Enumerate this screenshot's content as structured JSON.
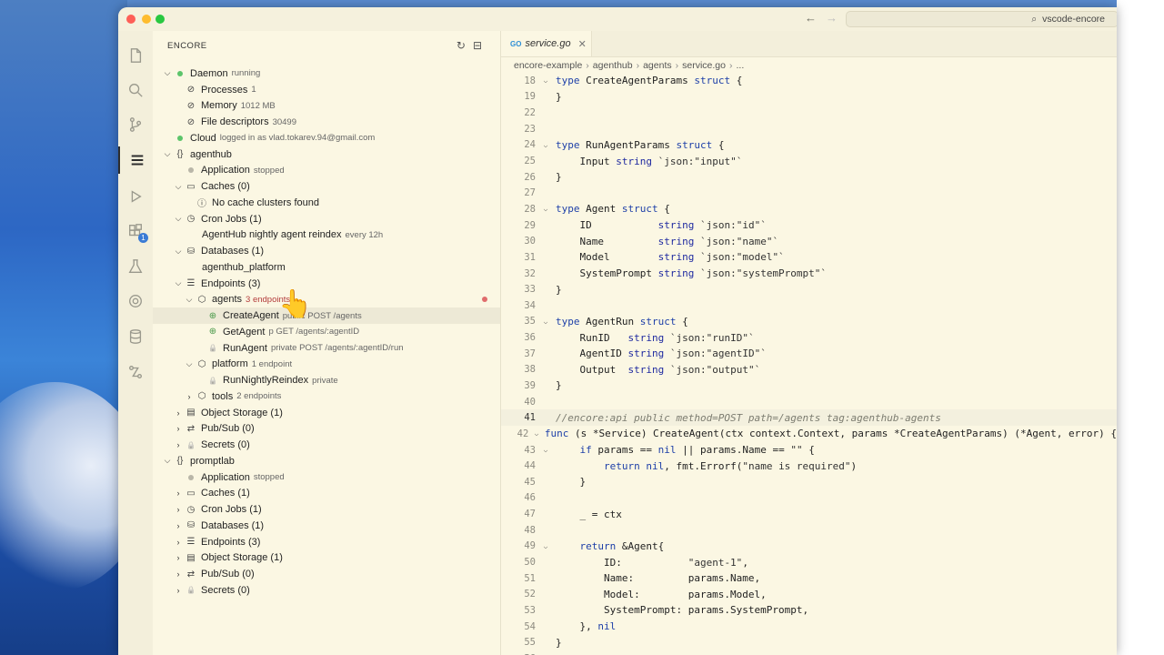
{
  "window": {
    "search_text": "vscode-encore"
  },
  "sidebar": {
    "header": "ENCORE",
    "rows": [
      {
        "indent": 0,
        "chev": "v",
        "icon": "status-dot-green",
        "label": "Daemon",
        "sub": "running"
      },
      {
        "indent": 1,
        "chev": "",
        "icon": "gauge-icon",
        "label": "Processes",
        "sub": "1"
      },
      {
        "indent": 1,
        "chev": "",
        "icon": "gauge-icon",
        "label": "Memory",
        "sub": "1012 MB"
      },
      {
        "indent": 1,
        "chev": "",
        "icon": "gauge-icon",
        "label": "File descriptors",
        "sub": "30499"
      },
      {
        "indent": 0,
        "chev": "",
        "icon": "status-dot-green",
        "label": "Cloud",
        "sub": "logged in as vlad.tokarev.94@gmail.com"
      },
      {
        "indent": 0,
        "chev": "v",
        "icon": "braces-icon",
        "label": "agenthub",
        "sub": ""
      },
      {
        "indent": 1,
        "chev": "",
        "icon": "status-dot-gray",
        "label": "Application",
        "sub": "stopped"
      },
      {
        "indent": 1,
        "chev": "v",
        "icon": "cache-icon",
        "label": "Caches (0)",
        "sub": ""
      },
      {
        "indent": 2,
        "chev": "",
        "icon": "info-icon",
        "label": "No cache clusters found",
        "sub": ""
      },
      {
        "indent": 1,
        "chev": "v",
        "icon": "clock-icon",
        "label": "Cron Jobs (1)",
        "sub": ""
      },
      {
        "indent": 2,
        "chev": "",
        "icon": "",
        "label": "AgentHub nightly agent reindex",
        "sub": "every 12h"
      },
      {
        "indent": 1,
        "chev": "v",
        "icon": "database-icon",
        "label": "Databases (1)",
        "sub": ""
      },
      {
        "indent": 2,
        "chev": "",
        "icon": "",
        "label": "agenthub_platform",
        "sub": ""
      },
      {
        "indent": 1,
        "chev": "v",
        "icon": "list-icon",
        "label": "Endpoints (3)",
        "sub": ""
      },
      {
        "indent": 2,
        "chev": "v",
        "icon": "box-icon",
        "label": "agents",
        "sub": "3 endpoints",
        "sub_red": true,
        "red_dot": true
      },
      {
        "indent": 3,
        "chev": "",
        "icon": "globe-icon",
        "label": "CreateAgent",
        "sub": "public  POST  /agents",
        "selected": true
      },
      {
        "indent": 3,
        "chev": "",
        "icon": "globe-icon",
        "label": "GetAgent",
        "sub": "p      GET  /agents/:agentID"
      },
      {
        "indent": 3,
        "chev": "",
        "icon": "lock-icon",
        "label": "RunAgent",
        "sub": "private  POST  /agents/:agentID/run"
      },
      {
        "indent": 2,
        "chev": "v",
        "icon": "box-icon",
        "label": "platform",
        "sub": "1 endpoint"
      },
      {
        "indent": 3,
        "chev": "",
        "icon": "lock-icon",
        "label": "RunNightlyReindex",
        "sub": "private"
      },
      {
        "indent": 2,
        "chev": ">",
        "icon": "box-icon",
        "label": "tools",
        "sub": "2 endpoints"
      },
      {
        "indent": 1,
        "chev": ">",
        "icon": "bucket-icon",
        "label": "Object Storage (1)",
        "sub": ""
      },
      {
        "indent": 1,
        "chev": ">",
        "icon": "pubsub-icon",
        "label": "Pub/Sub (0)",
        "sub": ""
      },
      {
        "indent": 1,
        "chev": ">",
        "icon": "lock-icon",
        "label": "Secrets (0)",
        "sub": ""
      },
      {
        "indent": 0,
        "chev": "v",
        "icon": "braces-icon",
        "label": "promptlab",
        "sub": ""
      },
      {
        "indent": 1,
        "chev": "",
        "icon": "status-dot-gray",
        "label": "Application",
        "sub": "stopped"
      },
      {
        "indent": 1,
        "chev": ">",
        "icon": "cache-icon",
        "label": "Caches (1)",
        "sub": ""
      },
      {
        "indent": 1,
        "chev": ">",
        "icon": "clock-icon",
        "label": "Cron Jobs (1)",
        "sub": ""
      },
      {
        "indent": 1,
        "chev": ">",
        "icon": "database-icon",
        "label": "Databases (1)",
        "sub": ""
      },
      {
        "indent": 1,
        "chev": ">",
        "icon": "list-icon",
        "label": "Endpoints (3)",
        "sub": ""
      },
      {
        "indent": 1,
        "chev": ">",
        "icon": "bucket-icon",
        "label": "Object Storage (1)",
        "sub": ""
      },
      {
        "indent": 1,
        "chev": ">",
        "icon": "pubsub-icon",
        "label": "Pub/Sub (0)",
        "sub": ""
      },
      {
        "indent": 1,
        "chev": ">",
        "icon": "lock-icon",
        "label": "Secrets (0)",
        "sub": ""
      }
    ]
  },
  "editor": {
    "tab_label": "service.go",
    "tab_badge": "GO",
    "breadcrumbs": [
      "encore-example",
      "agenthub",
      "agents",
      "service.go",
      "..."
    ],
    "active_line": "41",
    "lines": [
      {
        "n": "18",
        "fold": "v",
        "text": "type CreateAgentParams struct {"
      },
      {
        "n": "19",
        "fold": "",
        "text": "}"
      },
      {
        "n": "22",
        "fold": "",
        "text": ""
      },
      {
        "n": "23",
        "fold": "",
        "text": ""
      },
      {
        "n": "24",
        "fold": "v",
        "text": "type RunAgentParams struct {"
      },
      {
        "n": "25",
        "fold": "",
        "text": "    Input string `json:\"input\"`"
      },
      {
        "n": "26",
        "fold": "",
        "text": "}"
      },
      {
        "n": "27",
        "fold": "",
        "text": ""
      },
      {
        "n": "28",
        "fold": "v",
        "text": "type Agent struct {"
      },
      {
        "n": "29",
        "fold": "",
        "text": "    ID           string `json:\"id\"`"
      },
      {
        "n": "30",
        "fold": "",
        "text": "    Name         string `json:\"name\"`"
      },
      {
        "n": "31",
        "fold": "",
        "text": "    Model        string `json:\"model\"`"
      },
      {
        "n": "32",
        "fold": "",
        "text": "    SystemPrompt string `json:\"systemPrompt\"`"
      },
      {
        "n": "33",
        "fold": "",
        "text": "}"
      },
      {
        "n": "34",
        "fold": "",
        "text": ""
      },
      {
        "n": "35",
        "fold": "v",
        "text": "type AgentRun struct {"
      },
      {
        "n": "36",
        "fold": "",
        "text": "    RunID   string `json:\"runID\"`"
      },
      {
        "n": "37",
        "fold": "",
        "text": "    AgentID string `json:\"agentID\"`"
      },
      {
        "n": "38",
        "fold": "",
        "text": "    Output  string `json:\"output\"`"
      },
      {
        "n": "39",
        "fold": "",
        "text": "}"
      },
      {
        "n": "40",
        "fold": "",
        "text": ""
      },
      {
        "n": "41",
        "fold": "",
        "text": "//encore:api public method=POST path=/agents tag:agenthub-agents"
      },
      {
        "n": "42",
        "fold": "v",
        "text": "func (s *Service) CreateAgent(ctx context.Context, params *CreateAgentParams) (*Agent, error) {"
      },
      {
        "n": "43",
        "fold": "v",
        "text": "    if params == nil || params.Name == \"\" {"
      },
      {
        "n": "44",
        "fold": "",
        "text": "        return nil, fmt.Errorf(\"name is required\")"
      },
      {
        "n": "45",
        "fold": "",
        "text": "    }"
      },
      {
        "n": "46",
        "fold": "",
        "text": ""
      },
      {
        "n": "47",
        "fold": "",
        "text": "    _ = ctx"
      },
      {
        "n": "48",
        "fold": "",
        "text": ""
      },
      {
        "n": "49",
        "fold": "v",
        "text": "    return &Agent{"
      },
      {
        "n": "50",
        "fold": "",
        "text": "        ID:           \"agent-1\","
      },
      {
        "n": "51",
        "fold": "",
        "text": "        Name:         params.Name,"
      },
      {
        "n": "52",
        "fold": "",
        "text": "        Model:        params.Model,"
      },
      {
        "n": "53",
        "fold": "",
        "text": "        SystemPrompt: params.SystemPrompt,"
      },
      {
        "n": "54",
        "fold": "",
        "text": "    }, nil"
      },
      {
        "n": "55",
        "fold": "",
        "text": "}"
      },
      {
        "n": "56",
        "fold": "",
        "text": ""
      }
    ]
  },
  "activity_bar": {
    "items": [
      "files-icon",
      "search-icon",
      "source-control-icon",
      "encore-icon",
      "run-debug-icon",
      "extensions-icon",
      "testing-icon",
      "docker-icon",
      "database-icon",
      "remote-icon"
    ],
    "extensions_badge": "1"
  }
}
